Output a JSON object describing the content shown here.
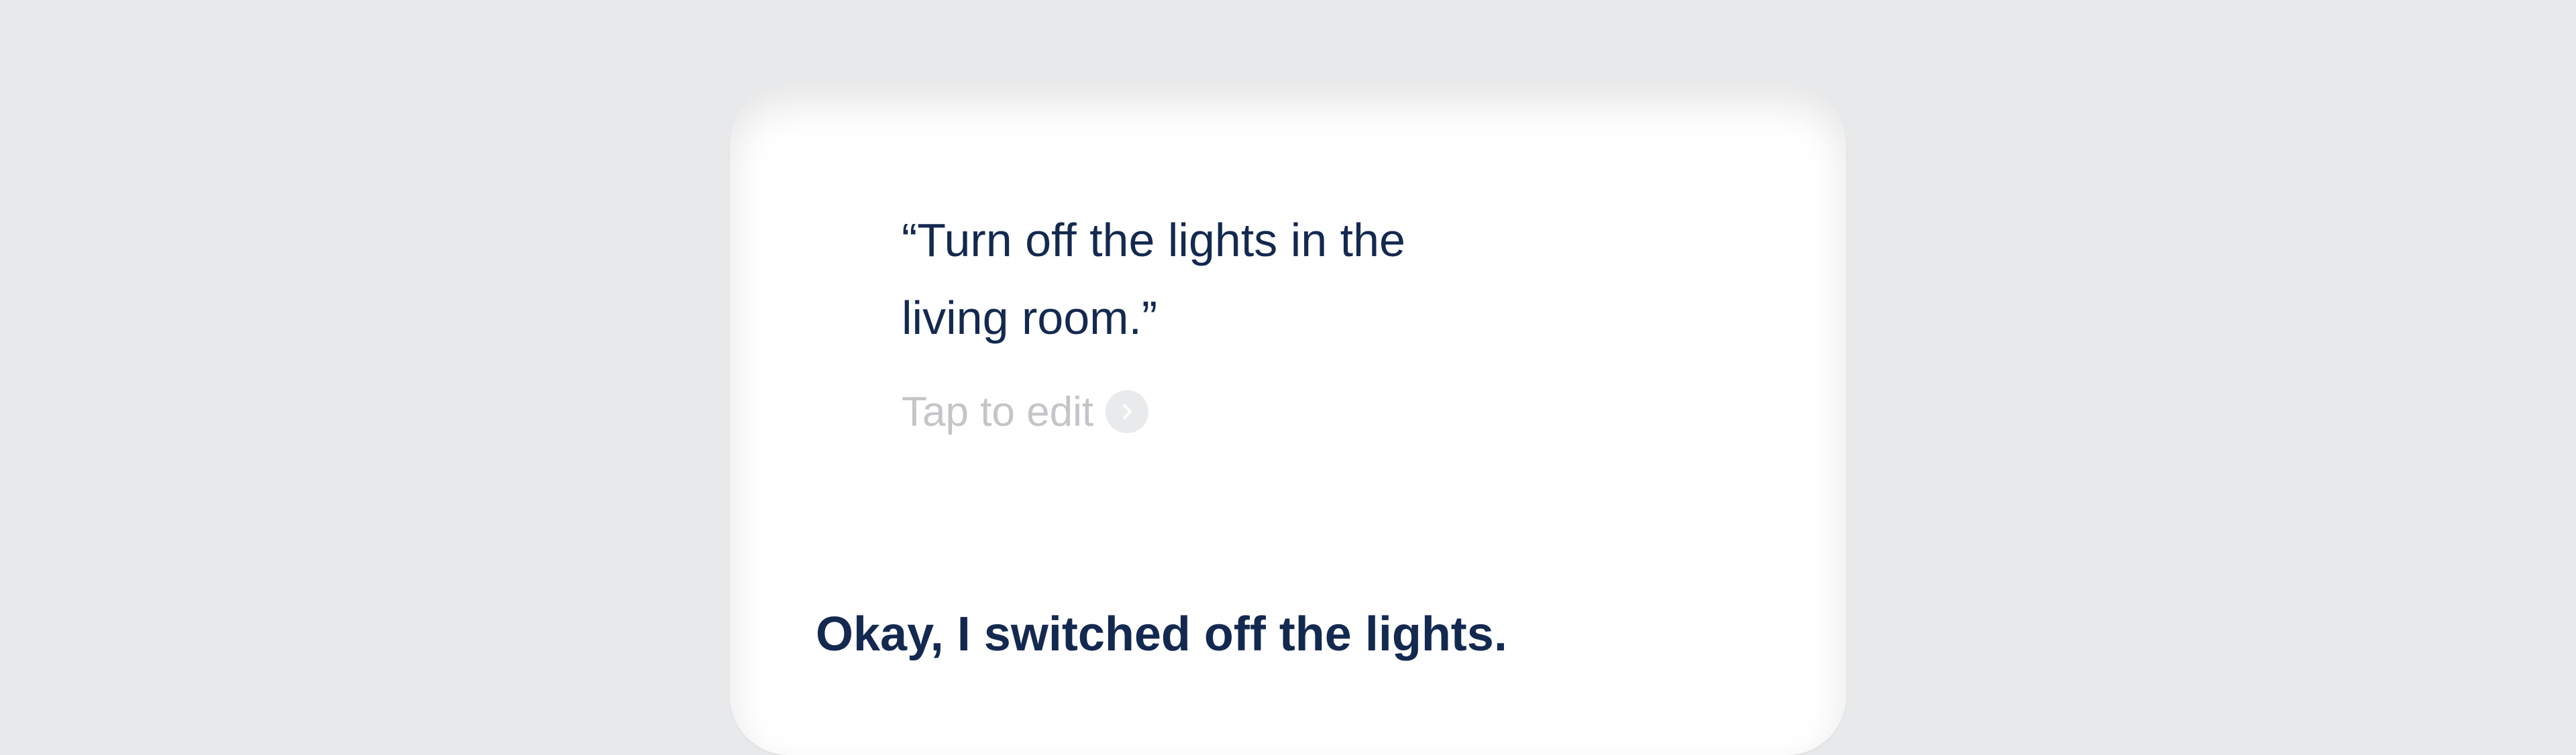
{
  "assistant": {
    "query_text": "“Turn off the lights in the living room.”",
    "edit_label": "Tap to edit",
    "edit_icon": "chevron-right-icon",
    "response_text": "Okay, I switched off the lights."
  },
  "colors": {
    "background": "#e8e9eb",
    "card": "#ffffff",
    "text_primary": "#14294f",
    "text_muted": "#c4c5c8"
  }
}
